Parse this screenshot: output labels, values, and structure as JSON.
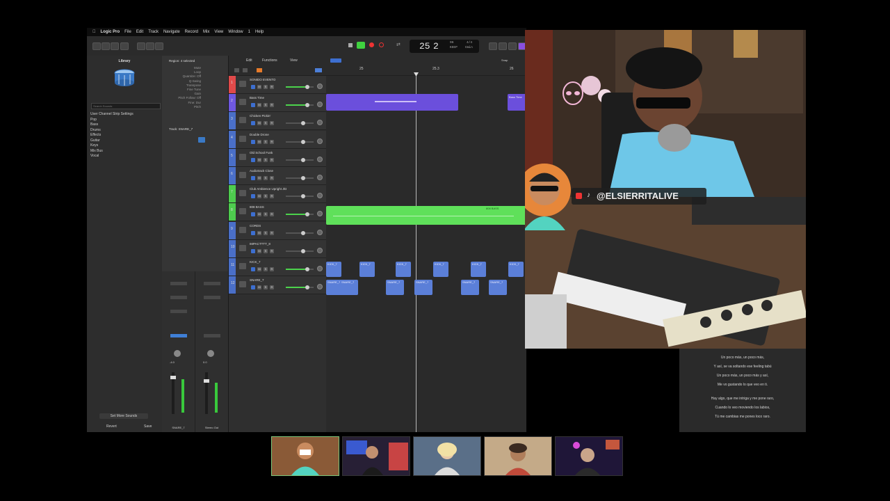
{
  "menu": {
    "app": "Logic Pro",
    "items": [
      "File",
      "Edit",
      "Track",
      "Navigate",
      "Record",
      "Mix",
      "View",
      "Window",
      "1",
      "Help"
    ]
  },
  "toolbar": {
    "lcd_bar": "25",
    "lcd_beat": "2",
    "lcd_tempo_small": "96",
    "lcd_key_small": "4/4",
    "lcd_sub1": "KEEP",
    "lcd_sub2": "Gmin"
  },
  "library": {
    "title": "Library",
    "search_placeholder": "Search Sounds",
    "items": [
      "User Channel Strip Settings",
      "Pop",
      "Bass",
      "Drums",
      "Effects",
      "Guitar",
      "Keys",
      "Mix Bus",
      "Vocal"
    ],
    "footer_button": "Set More Sounds",
    "revert": "Revert",
    "save": "Save"
  },
  "inspector": {
    "region_header": "Region: 4 selected",
    "track_header": "Track: SNARE_7",
    "params": [
      "Mute",
      "Loop",
      "Quantize: Off",
      "Q-Swing",
      "Transpose",
      "Fine Tune",
      "Gain",
      "Pitch Follow: Off",
      "Fine: Dur",
      "Pitch"
    ]
  },
  "arrange": {
    "menu": [
      "Edit",
      "Functions",
      "View"
    ],
    "ruler": [
      "25",
      "25.3",
      "26"
    ],
    "snap_label": "Snap"
  },
  "tracks": [
    {
      "num": "1",
      "name": "SONIDO EVENTO",
      "color": "#e04a4a"
    },
    {
      "num": "2",
      "name": "Bass Time",
      "color": "#6f58e0"
    },
    {
      "num": "3",
      "name": "Chicken Pickin'",
      "color": "#4a6fc8"
    },
    {
      "num": "4",
      "name": "Double Drone",
      "color": "#4a6fc8"
    },
    {
      "num": "5",
      "name": "Old School Funk",
      "color": "#4a6fc8"
    },
    {
      "num": "6",
      "name": "Audiotrack Close",
      "color": "#4a6fc8"
    },
    {
      "num": "7",
      "name": "Club Ambience Upright Jkt",
      "color": "#4ecc4e"
    },
    {
      "num": "8",
      "name": "808 BASS",
      "color": "#4ecc4e"
    },
    {
      "num": "9",
      "name": "CORDS",
      "color": "#4a6fc8"
    },
    {
      "num": "10",
      "name": "IMPACTTTT_8",
      "color": "#4a6fc8"
    },
    {
      "num": "11",
      "name": "KICK_7",
      "color": "#4a6fc8"
    },
    {
      "num": "12",
      "name": "SNARE_7",
      "color": "#4a6fc8"
    }
  ],
  "regions": {
    "purple_label": "Bass Time",
    "green_label": "808 BASS",
    "kick_label": "KICK_7",
    "snare_label": "SNARE_7"
  },
  "mixer": {
    "left_label": "SNARE_7",
    "right_label": "Stereo Out",
    "left_value": "-4.0",
    "right_value": "0.0"
  },
  "stream": {
    "handle": "@ELSIERRITALIVE"
  },
  "lyrics": [
    "Un poco más, un poco más,",
    "Y así, se va soltando ese feeling tabú",
    "Un poco más, un poco más y así,",
    "Me vo gustando lo que veo en ti.",
    "Hay algo, que me intriga y me pone raro,",
    "Cuando lo veo moviendo los labios,",
    "Tú me cambias me pones loco raro."
  ],
  "colors": {
    "accent_blue": "#2a6fd6",
    "region_purple": "#6b4fdc",
    "region_green": "#5fe05a",
    "region_blue": "#5b7fd8"
  }
}
